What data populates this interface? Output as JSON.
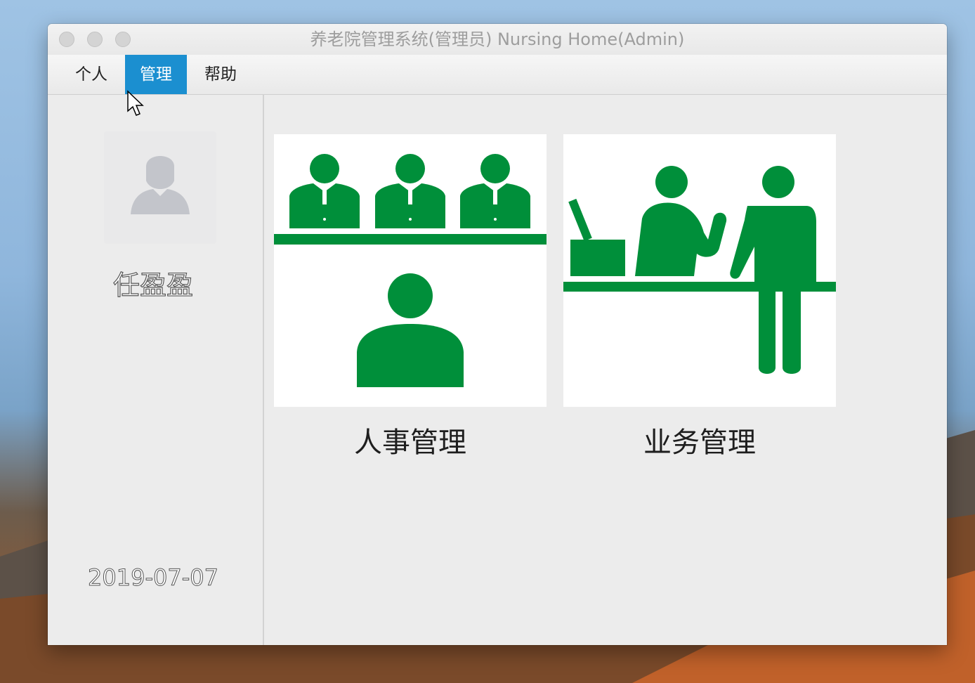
{
  "window": {
    "title": "养老院管理系统(管理员) Nursing Home(Admin)"
  },
  "menu": [
    {
      "label": "个人",
      "selected": false
    },
    {
      "label": "管理",
      "selected": true
    },
    {
      "label": "帮助",
      "selected": false
    }
  ],
  "sidebar": {
    "username": "任盈盈",
    "date": "2019-07-07",
    "avatar_icon": "user-placeholder-icon"
  },
  "modules": [
    {
      "label": "人事管理",
      "icon": "personnel-management-icon"
    },
    {
      "label": "业务管理",
      "icon": "business-management-icon"
    }
  ],
  "colors": {
    "accent": "#1b8fd0",
    "icon_green": "#008f3a"
  }
}
